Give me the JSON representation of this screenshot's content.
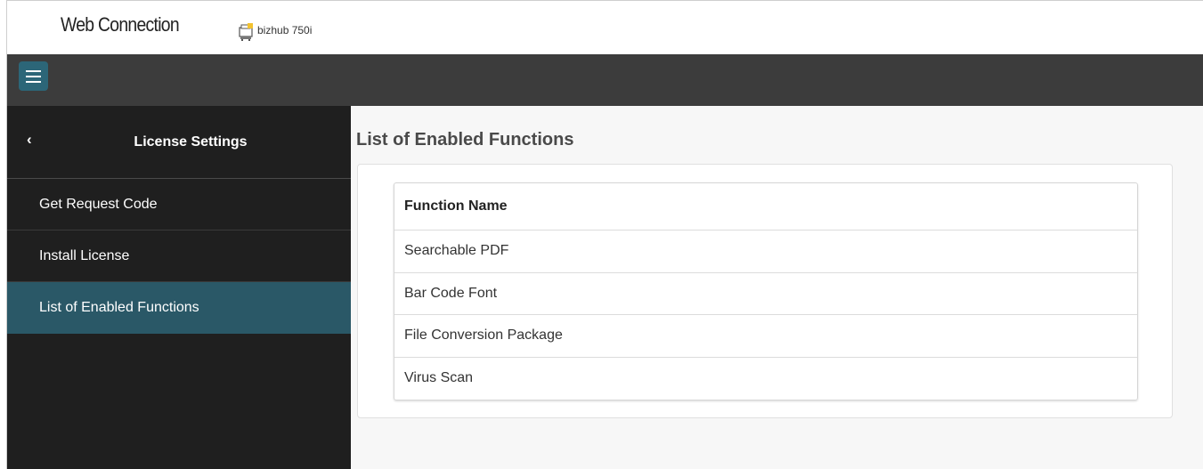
{
  "header": {
    "brand": "Web Connection",
    "device_name": "bizhub 750i",
    "icon": "printer-icon"
  },
  "navbar": {
    "menu_icon": "hamburger-menu-icon"
  },
  "sidebar": {
    "title": "License Settings",
    "back_icon": "chevron-left-icon",
    "items": [
      {
        "label": "Get Request Code",
        "active": false
      },
      {
        "label": "Install License",
        "active": false
      },
      {
        "label": "List of Enabled Functions",
        "active": true
      }
    ]
  },
  "main": {
    "title": "List of Enabled Functions",
    "table": {
      "header": "Function Name",
      "rows": [
        "Searchable PDF",
        "Bar Code Font",
        "File Conversion Package",
        "Virus Scan"
      ]
    }
  },
  "colors": {
    "navbar": "#3c3c3c",
    "sidebar": "#1f1f1f",
    "active_item": "#2a5867",
    "menu_button": "#2c6678",
    "content_bg": "#f7f7f7"
  }
}
